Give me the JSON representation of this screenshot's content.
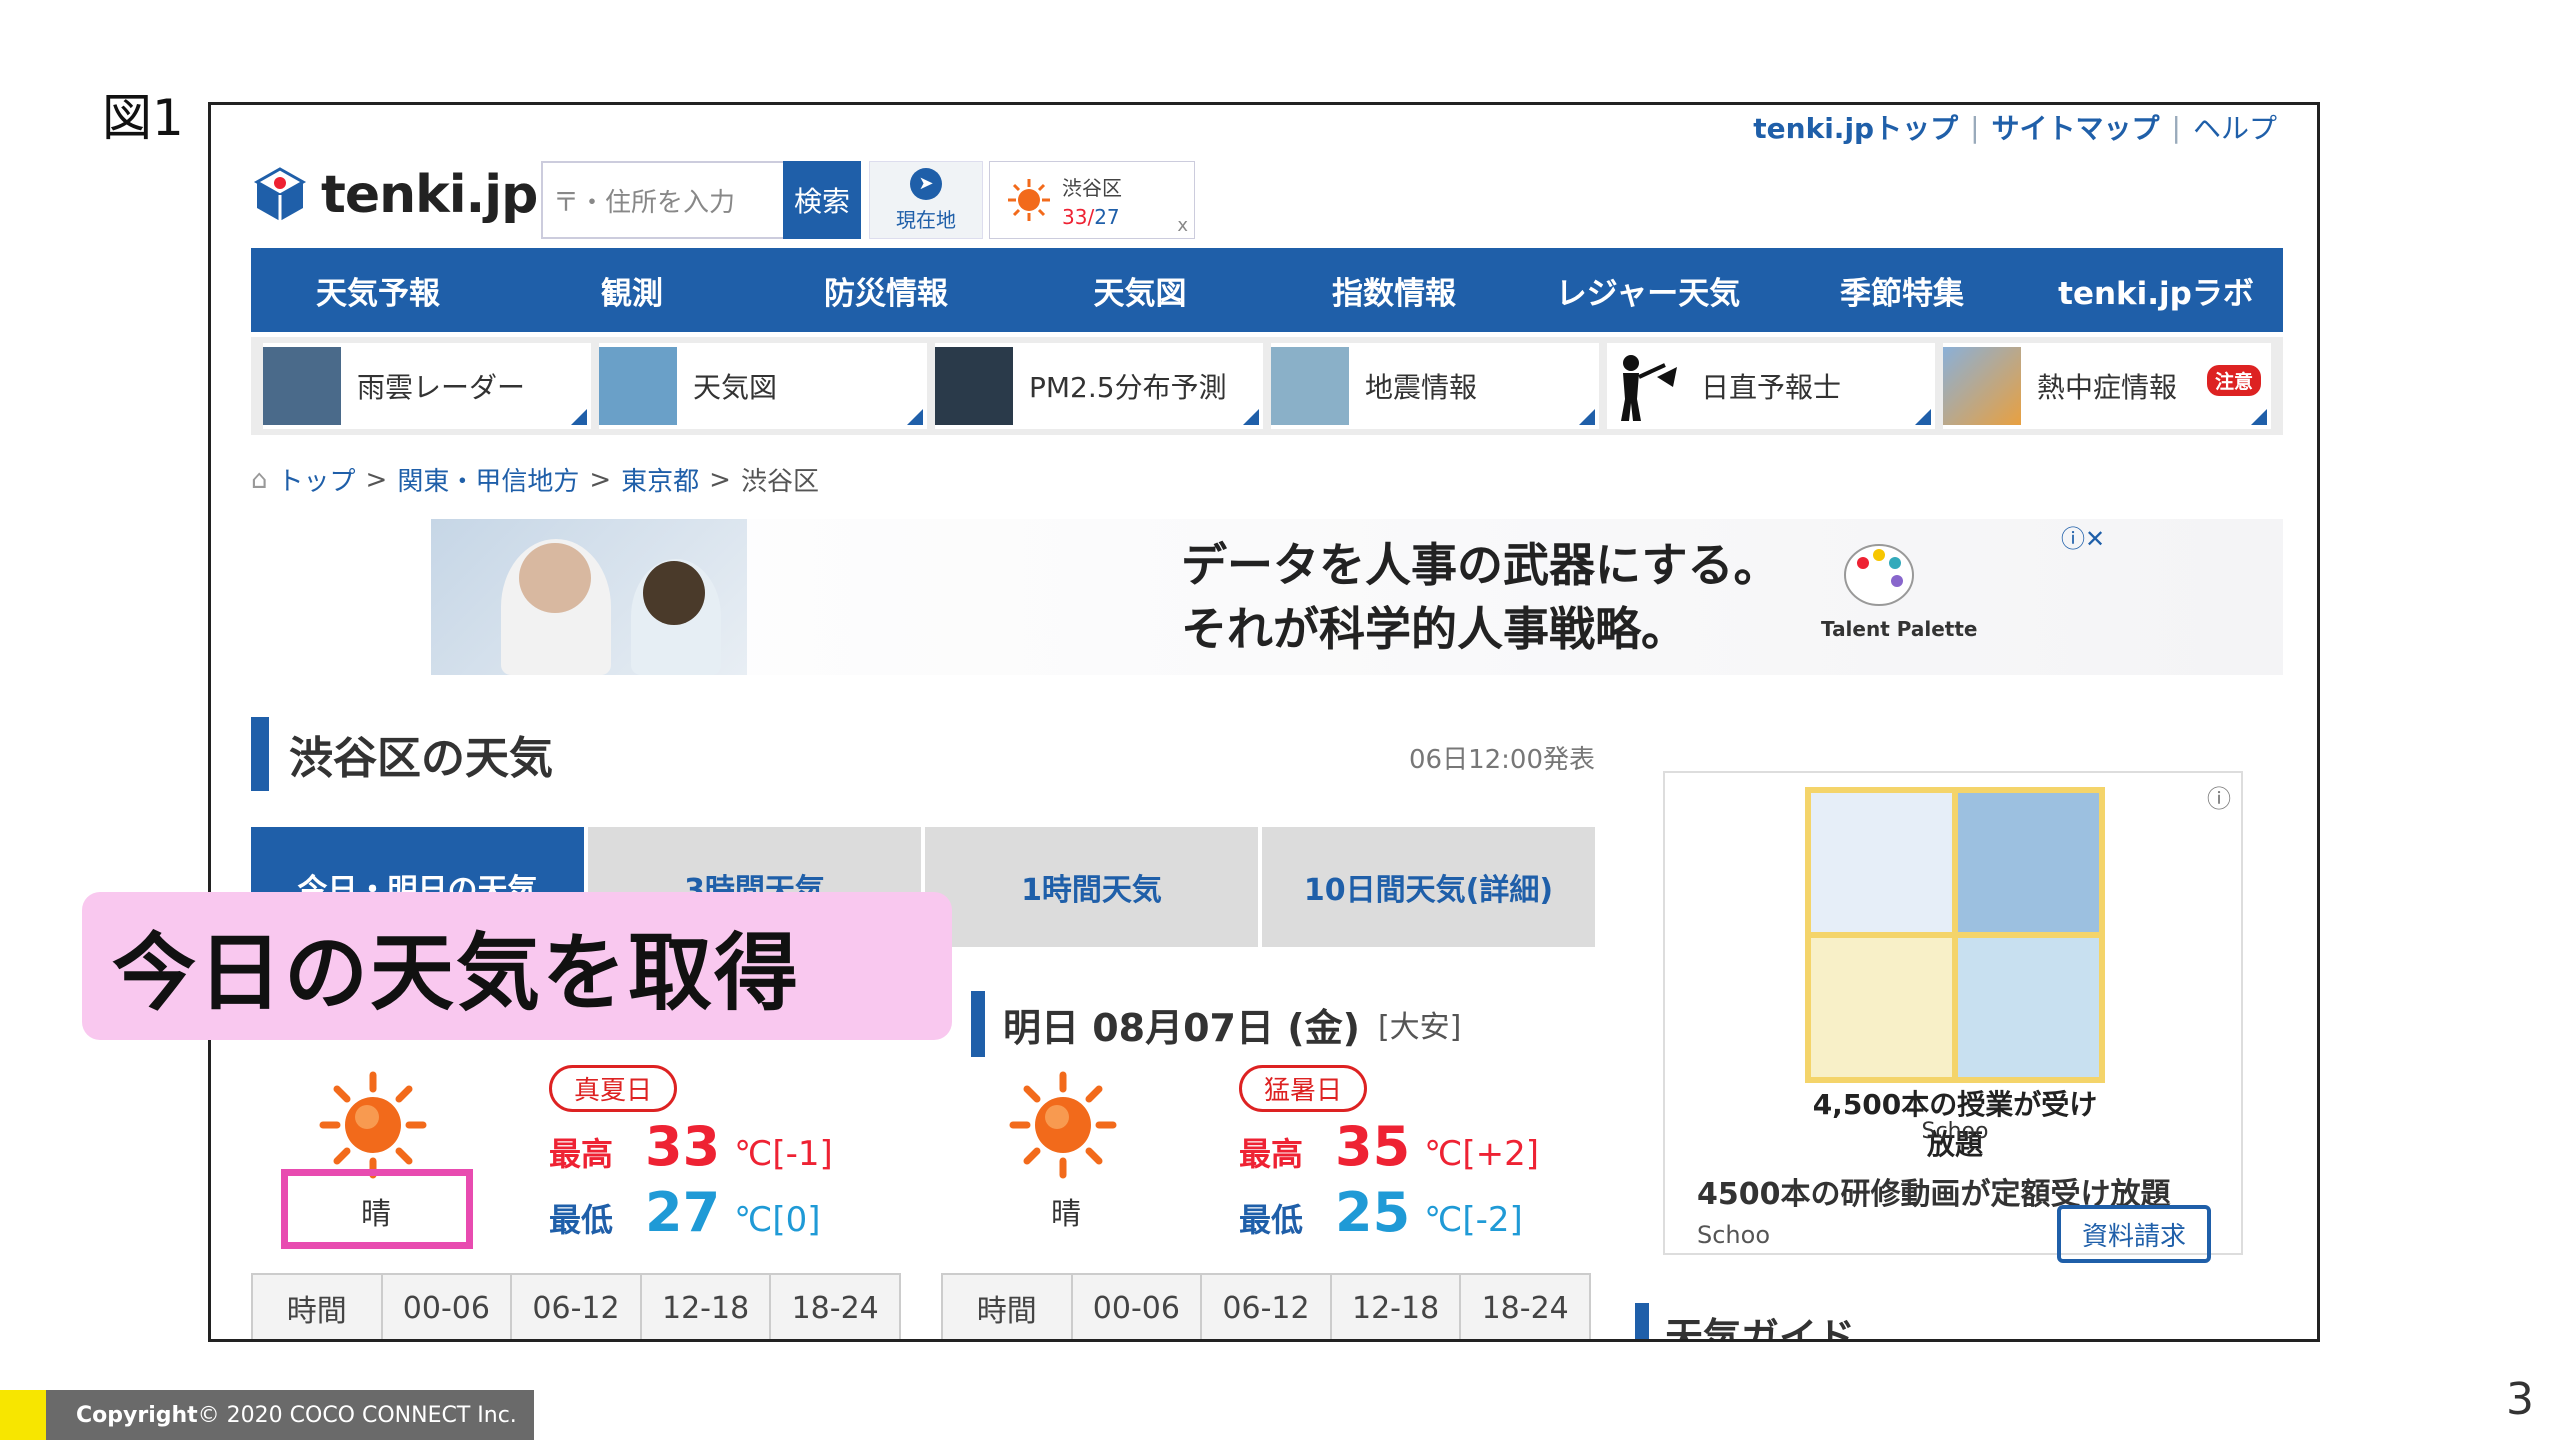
{
  "slide": {
    "figure_label": "図1",
    "page_number": "3",
    "footer_bold": "Copyright",
    "footer_text": " © 2020 COCO CONNECT Inc.",
    "callout": "今日の天気を取得"
  },
  "header": {
    "links": [
      "tenki.jpトップ",
      "サイトマップ",
      "ヘルプ"
    ],
    "logo_text": "tenki.jp",
    "search_placeholder": "〒・住所を入力",
    "search_button": "検索",
    "current_location": "現在地",
    "mini_weather": {
      "location": "渋谷区",
      "high": "33",
      "low": "27",
      "close": "x"
    }
  },
  "nav": [
    "天気予報",
    "観測",
    "防災情報",
    "天気図",
    "指数情報",
    "レジャー天気",
    "季節特集",
    "tenki.jpラボ"
  ],
  "quick_links": [
    {
      "label": "雨雲レーダー",
      "thumb": "#4a6a8a"
    },
    {
      "label": "天気図",
      "thumb": "#6aa0c8"
    },
    {
      "label": "PM2.5分布予測",
      "thumb": "#2a3a4a"
    },
    {
      "label": "地震情報",
      "thumb": "#8ab0c8"
    },
    {
      "label": "日直予報士",
      "thumb": "#ffffff"
    },
    {
      "label": "熱中症情報",
      "thumb": "#e8a040",
      "badge": "注意"
    }
  ],
  "breadcrumb": {
    "home": "トップ",
    "links": [
      "関東・甲信地方",
      "東京都"
    ],
    "current": "渋谷区",
    "sep": ">"
  },
  "banner_ad": {
    "line1": "データを人事の武器にする。",
    "line2": "それが科学的人事戦略。",
    "brand": "Talent Palette",
    "icons": "ⓘ✕"
  },
  "page": {
    "title": "渋谷区の天気",
    "issued": "06日12:00発表",
    "tabs": [
      "今日・明日の天気",
      "3時間天気",
      "1時間天気",
      "10日間天気(詳細)"
    ]
  },
  "today": {
    "tag": "真夏日",
    "weather": "晴",
    "high_label": "最高",
    "high": "33",
    "high_diff": "[-1]",
    "low_label": "最低",
    "low": "27",
    "low_diff": "[0]",
    "unit": "℃"
  },
  "tomorrow": {
    "heading": "明日 08月07日 (金)",
    "rokuyo": "[大安]",
    "tag": "猛暑日",
    "weather": "晴",
    "high_label": "最高",
    "high": "35",
    "high_diff": "[+2]",
    "low_label": "最低",
    "low": "25",
    "low_diff": "[-2]",
    "unit": "℃"
  },
  "time_table": [
    "時間",
    "00-06",
    "06-12",
    "12-18",
    "18-24"
  ],
  "side_ad": {
    "caption": "4,500本の授業が受け放題",
    "brand": "Schoo",
    "headline": "4500本の研修動画が定額受け放題",
    "source": "Schoo",
    "button": "資料請求",
    "info": "ⓘ"
  },
  "guide_title": "天気ガイド"
}
